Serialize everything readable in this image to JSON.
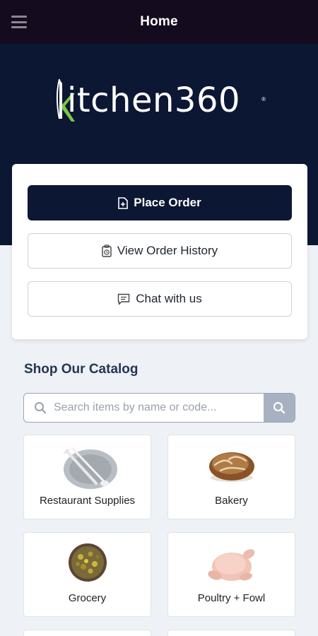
{
  "header": {
    "title": "Home",
    "menu_icon": "hamburger-menu-icon"
  },
  "brand": {
    "logo_text": "itchen360",
    "logo_mark": "K",
    "logo_accent": "#7ac943",
    "trademark": "®"
  },
  "actions": {
    "place_order": {
      "label": "Place Order",
      "icon": "document-plus-icon"
    },
    "order_history": {
      "label": "View Order History",
      "icon": "clipboard-clock-icon"
    },
    "chat": {
      "label": "Chat with us",
      "icon": "chat-bubble-icon"
    }
  },
  "catalog": {
    "title": "Shop Our Catalog",
    "search": {
      "placeholder": "Search items by name or code...",
      "value": "",
      "icon": "search-icon"
    },
    "categories": [
      {
        "label": "Restaurant Supplies",
        "icon": "plate-cutlery-image"
      },
      {
        "label": "Bakery",
        "icon": "bread-loaf-image"
      },
      {
        "label": "Grocery",
        "icon": "spice-bowl-image"
      },
      {
        "label": "Poultry + Fowl",
        "icon": "raw-chicken-image"
      }
    ]
  },
  "colors": {
    "topbar": "#150b1e",
    "navy": "#0b1733",
    "background": "#eef1f5",
    "section_title": "#243654"
  }
}
